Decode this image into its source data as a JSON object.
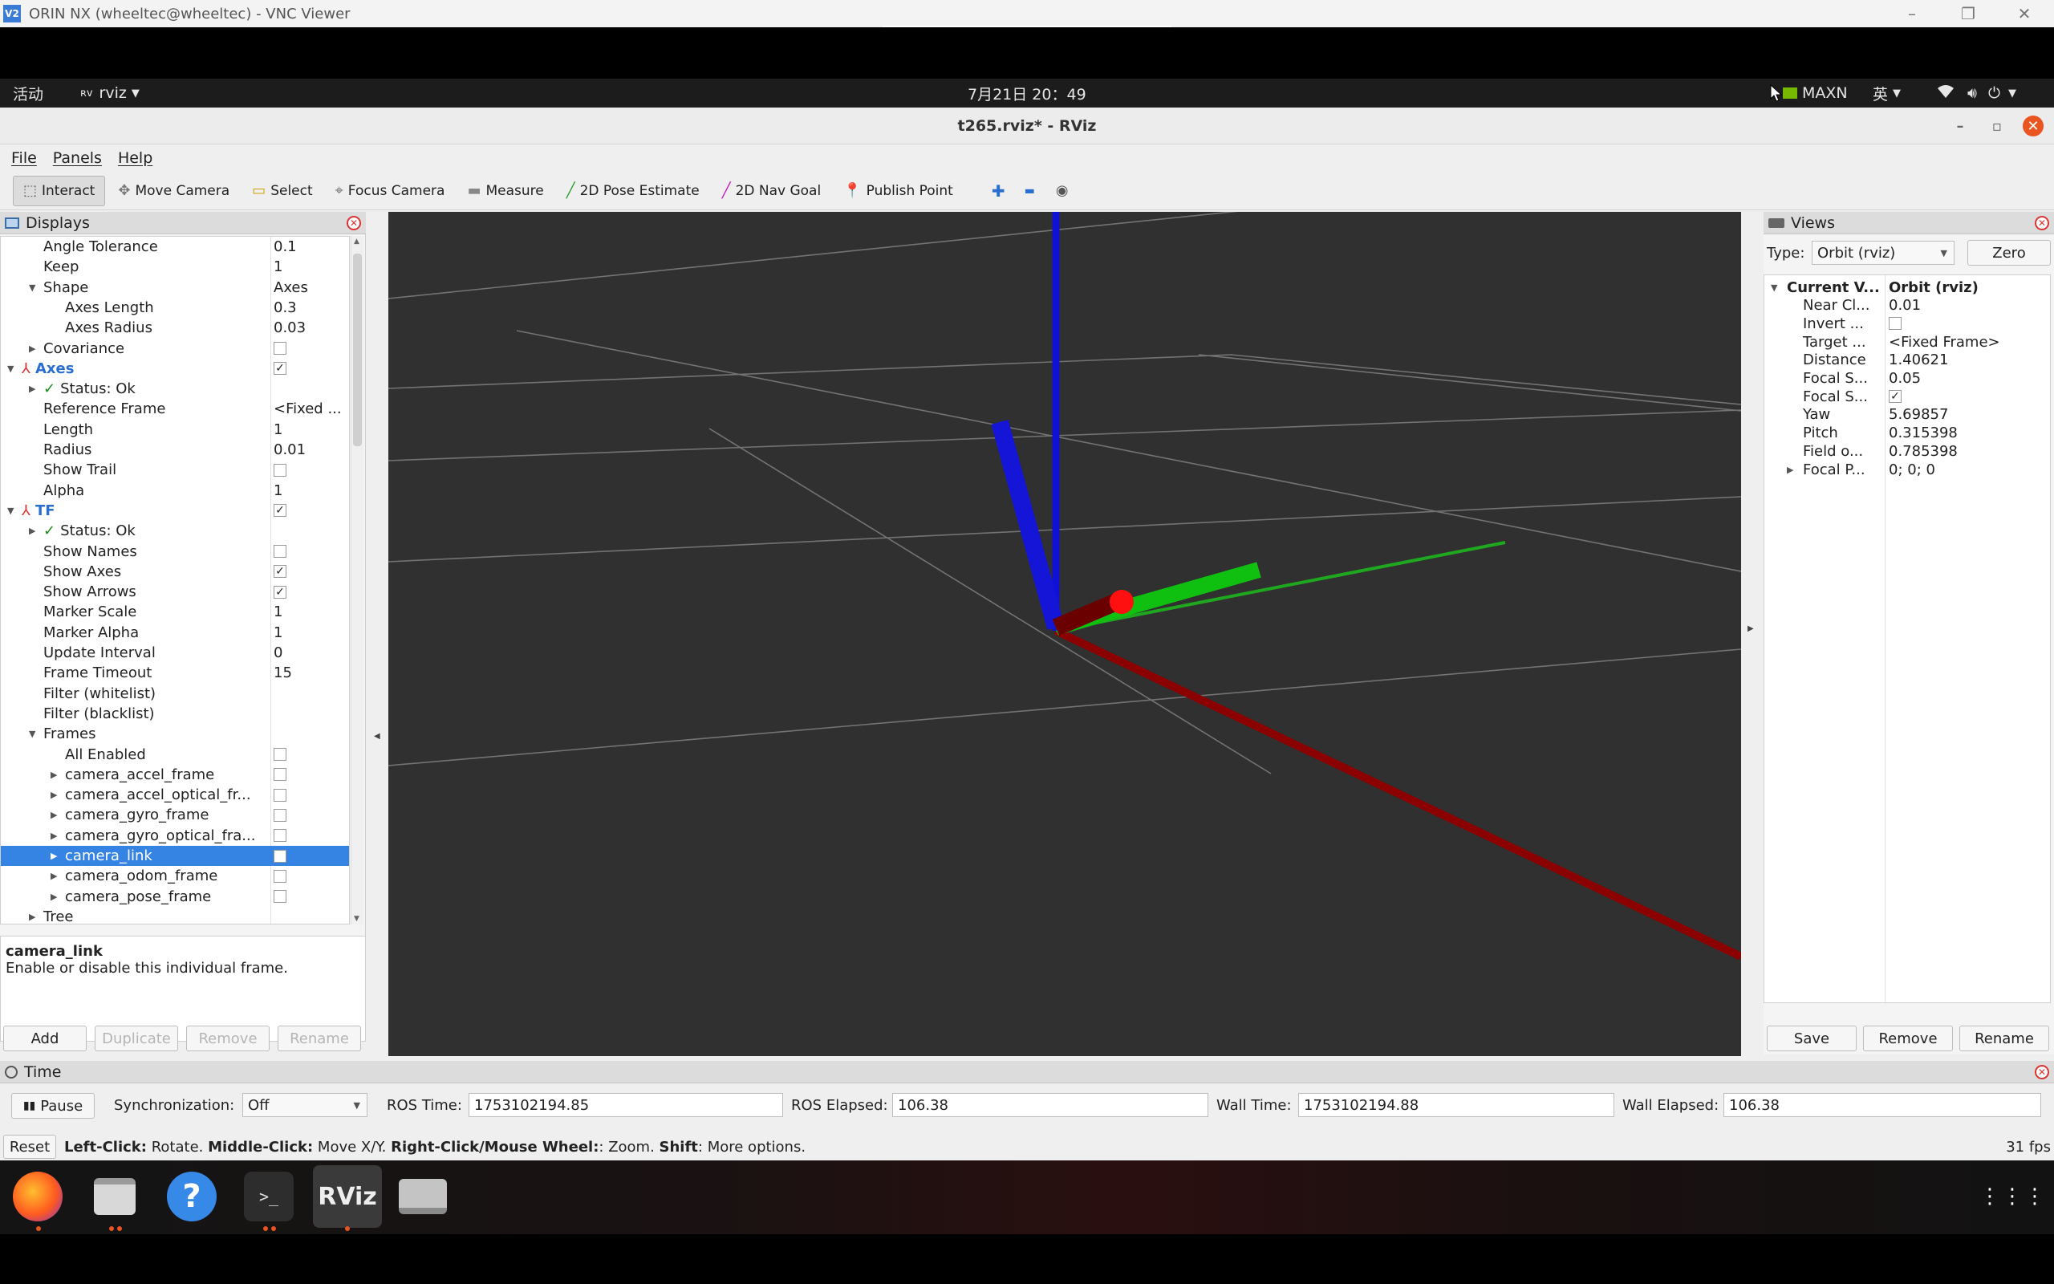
{
  "vnc": {
    "title": "ORIN NX (wheeltec@wheeltec) - VNC Viewer",
    "logo": "V2",
    "controls": {
      "minimize": "–",
      "restore": "❐",
      "close": "✕"
    }
  },
  "gnome": {
    "activities": "活动",
    "app_menu": "rviz",
    "clock": "7月21日  20：49",
    "power_mode": "MAXN",
    "input_method": "英"
  },
  "rviz": {
    "window_title": "t265.rviz* - RViz",
    "window_controls": {
      "minimize": "–",
      "restore": "▫",
      "close": "✕"
    },
    "menus": [
      "File",
      "Panels",
      "Help"
    ],
    "tools": [
      {
        "label": "Interact",
        "icon": "interact-icon",
        "glyph": "⬚",
        "color": "#555555"
      },
      {
        "label": "Move Camera",
        "icon": "move-camera-icon",
        "glyph": "✥",
        "color": "#777777"
      },
      {
        "label": "Select",
        "icon": "select-icon",
        "glyph": "▭",
        "color": "#c8a000"
      },
      {
        "label": "Focus Camera",
        "icon": "focus-camera-icon",
        "glyph": "⌖",
        "color": "#777777"
      },
      {
        "label": "Measure",
        "icon": "measure-icon",
        "glyph": "▬",
        "color": "#888888"
      },
      {
        "label": "2D Pose Estimate",
        "icon": "pose-estimate-icon",
        "glyph": "╱",
        "color": "#2ca02c"
      },
      {
        "label": "2D Nav Goal",
        "icon": "nav-goal-icon",
        "glyph": "╱",
        "color": "#c020c0"
      },
      {
        "label": "Publish Point",
        "icon": "publish-point-icon",
        "glyph": "📍",
        "color": "#d62728"
      }
    ],
    "tool_extras": {
      "add": "✚",
      "remove": "▬",
      "eye": "◉"
    }
  },
  "displays": {
    "title": "Displays",
    "rows": [
      {
        "label": "Angle Tolerance",
        "value": "0.1",
        "indent": 1
      },
      {
        "label": "Keep",
        "value": "1",
        "indent": 1
      },
      {
        "label": "Shape",
        "value": "Axes",
        "indent": 1,
        "arrow": "expanded"
      },
      {
        "label": "Axes Length",
        "value": "0.3",
        "indent": 2
      },
      {
        "label": "Axes Radius",
        "value": "0.03",
        "indent": 2
      },
      {
        "label": "Covariance",
        "value": "",
        "indent": 1,
        "arrow": "collapsed",
        "check": "unchecked"
      },
      {
        "label": "Axes",
        "value": "",
        "indent": 0,
        "arrow": "expanded",
        "check": "checked",
        "style": "display",
        "icon": "axes-icon"
      },
      {
        "label": "Status: Ok",
        "value": "",
        "indent": 1,
        "arrow": "collapsed",
        "status": true
      },
      {
        "label": "Reference Frame",
        "value": "<Fixed ...",
        "indent": 1
      },
      {
        "label": "Length",
        "value": "1",
        "indent": 1
      },
      {
        "label": "Radius",
        "value": "0.01",
        "indent": 1
      },
      {
        "label": "Show Trail",
        "value": "",
        "indent": 1,
        "check": "unchecked"
      },
      {
        "label": "Alpha",
        "value": "1",
        "indent": 1
      },
      {
        "label": "TF",
        "value": "",
        "indent": 0,
        "arrow": "expanded",
        "check": "checked",
        "style": "display",
        "icon": "tf-icon"
      },
      {
        "label": "Status: Ok",
        "value": "",
        "indent": 1,
        "arrow": "collapsed",
        "status": true
      },
      {
        "label": "Show Names",
        "value": "",
        "indent": 1,
        "check": "unchecked"
      },
      {
        "label": "Show Axes",
        "value": "",
        "indent": 1,
        "check": "checked"
      },
      {
        "label": "Show Arrows",
        "value": "",
        "indent": 1,
        "check": "checked"
      },
      {
        "label": "Marker Scale",
        "value": "1",
        "indent": 1
      },
      {
        "label": "Marker Alpha",
        "value": "1",
        "indent": 1
      },
      {
        "label": "Update Interval",
        "value": "0",
        "indent": 1
      },
      {
        "label": "Frame Timeout",
        "value": "15",
        "indent": 1
      },
      {
        "label": "Filter (whitelist)",
        "value": "",
        "indent": 1
      },
      {
        "label": "Filter (blacklist)",
        "value": "",
        "indent": 1
      },
      {
        "label": "Frames",
        "value": "",
        "indent": 1,
        "arrow": "expanded"
      },
      {
        "label": "All Enabled",
        "value": "",
        "indent": 2,
        "check": "unchecked"
      },
      {
        "label": "camera_accel_frame",
        "value": "",
        "indent": 2,
        "arrow": "collapsed",
        "check": "unchecked"
      },
      {
        "label": "camera_accel_optical_fr...",
        "value": "",
        "indent": 2,
        "arrow": "collapsed",
        "check": "unchecked"
      },
      {
        "label": "camera_gyro_frame",
        "value": "",
        "indent": 2,
        "arrow": "collapsed",
        "check": "unchecked"
      },
      {
        "label": "camera_gyro_optical_fra...",
        "value": "",
        "indent": 2,
        "arrow": "collapsed",
        "check": "unchecked"
      },
      {
        "label": "camera_link",
        "value": "",
        "indent": 2,
        "arrow": "collapsed",
        "check": "unchecked",
        "selected": true
      },
      {
        "label": "camera_odom_frame",
        "value": "",
        "indent": 2,
        "arrow": "collapsed",
        "check": "unchecked"
      },
      {
        "label": "camera_pose_frame",
        "value": "",
        "indent": 2,
        "arrow": "collapsed",
        "check": "unchecked"
      },
      {
        "label": "Tree",
        "value": "",
        "indent": 1,
        "arrow": "collapsed"
      }
    ],
    "description": {
      "title": "camera_link",
      "text": "Enable or disable this individual frame."
    },
    "buttons": {
      "add": "Add",
      "duplicate": "Duplicate",
      "remove": "Remove",
      "rename": "Rename"
    }
  },
  "views": {
    "title": "Views",
    "type_label": "Type:",
    "type_value": "Orbit (rviz)",
    "zero": "Zero",
    "rows": [
      {
        "label": "Current V...",
        "value": "Orbit (rviz)",
        "indent": 0,
        "arrow": "expanded",
        "bold": true
      },
      {
        "label": "Near Cl...",
        "value": "0.01",
        "indent": 1
      },
      {
        "label": "Invert ...",
        "value": "",
        "indent": 1,
        "check": "unchecked"
      },
      {
        "label": "Target ...",
        "value": "<Fixed Frame>",
        "indent": 1
      },
      {
        "label": "Distance",
        "value": "1.40621",
        "indent": 1
      },
      {
        "label": "Focal S...",
        "value": "0.05",
        "indent": 1
      },
      {
        "label": "Focal S...",
        "value": "",
        "indent": 1,
        "check": "checked"
      },
      {
        "label": "Yaw",
        "value": "5.69857",
        "indent": 1
      },
      {
        "label": "Pitch",
        "value": "0.315398",
        "indent": 1
      },
      {
        "label": "Field o...",
        "value": "0.785398",
        "indent": 1
      },
      {
        "label": "Focal P...",
        "value": "0; 0; 0",
        "indent": 1,
        "arrow": "collapsed"
      }
    ],
    "buttons": {
      "save": "Save",
      "remove": "Remove",
      "rename": "Rename"
    }
  },
  "time": {
    "title": "Time",
    "pause": "Pause",
    "sync_label": "Synchronization:",
    "sync_value": "Off",
    "ros_time_label": "ROS Time:",
    "ros_time": "1753102194.85",
    "ros_elapsed_label": "ROS Elapsed:",
    "ros_elapsed": "106.38",
    "wall_time_label": "Wall Time:",
    "wall_time": "1753102194.88",
    "wall_elapsed_label": "Wall Elapsed:",
    "wall_elapsed": "106.38"
  },
  "status": {
    "reset": "Reset",
    "hint_parts": [
      {
        "text": "Left-Click:",
        "bold": true
      },
      {
        "text": " Rotate. ",
        "bold": false
      },
      {
        "text": "Middle-Click:",
        "bold": true
      },
      {
        "text": " Move X/Y. ",
        "bold": false
      },
      {
        "text": "Right-Click/Mouse Wheel:",
        "bold": true
      },
      {
        "text": ": Zoom. ",
        "bold": false
      },
      {
        "text": "Shift",
        "bold": true
      },
      {
        "text": ": More options.",
        "bold": false
      }
    ],
    "fps": "31 fps"
  },
  "dock": {
    "rviz_label": "RViz",
    "help_glyph": "?",
    "terminal_glyph": ">_",
    "apps_glyph": "⋮⋮⋮"
  },
  "colors": {
    "accent": "#e95420",
    "selection": "#3584e4",
    "display_blue": "#2a6fd0",
    "viewport_bg": "#303030"
  }
}
